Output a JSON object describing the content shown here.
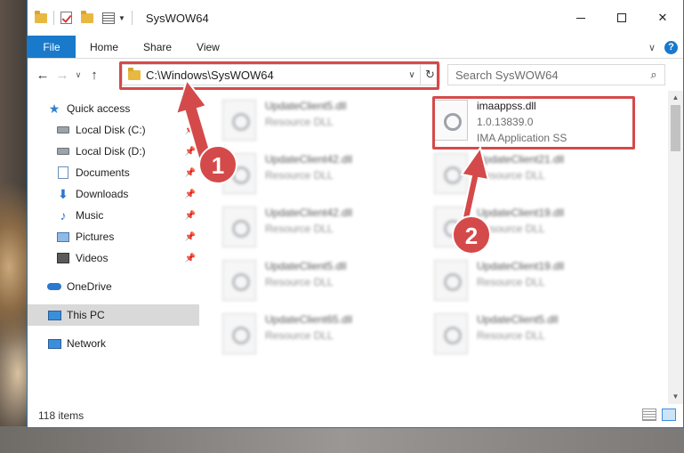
{
  "window": {
    "title": "SysWOW64",
    "controls": {
      "minimize": "",
      "maximize": "",
      "close": "✕"
    }
  },
  "ribbon": {
    "file_tab": "File",
    "tabs": [
      "Home",
      "Share",
      "View"
    ]
  },
  "address": {
    "path": "C:\\Windows\\SysWOW64",
    "search_placeholder": "Search SysWOW64"
  },
  "nav": {
    "items": [
      {
        "label": "Quick access",
        "icon": "star-icon"
      },
      {
        "label": "Local Disk (C:)",
        "icon": "drive-icon",
        "pinned": true
      },
      {
        "label": "Local Disk (D:)",
        "icon": "drive-icon",
        "pinned": true
      },
      {
        "label": "Documents",
        "icon": "documents-icon",
        "pinned": true
      },
      {
        "label": "Downloads",
        "icon": "download-icon",
        "pinned": true
      },
      {
        "label": "Music",
        "icon": "music-icon",
        "pinned": true
      },
      {
        "label": "Pictures",
        "icon": "pictures-icon",
        "pinned": true
      },
      {
        "label": "Videos",
        "icon": "videos-icon",
        "pinned": true
      },
      {
        "label": "OneDrive",
        "icon": "cloud-icon"
      },
      {
        "label": "This PC",
        "icon": "monitor-icon",
        "selected": true
      },
      {
        "label": "Network",
        "icon": "network-icon"
      }
    ]
  },
  "files": {
    "highlighted": {
      "name": "imaappss.dll",
      "version": "1.0.13839.0",
      "description": "IMA Application SS"
    },
    "left_column": [
      {
        "name": "UpdateClient5.dll",
        "type": "Resource DLL"
      },
      {
        "name": "UpdateClient42.dll",
        "type": "Resource DLL"
      },
      {
        "name": "UpdateClient42.dll",
        "type": "Resource DLL"
      },
      {
        "name": "UpdateClient5.dll",
        "type": "Resource DLL"
      },
      {
        "name": "UpdateClient65.dll",
        "type": "Resource DLL"
      }
    ],
    "right_column": [
      {
        "name": "UpdateClient21.dll",
        "type": "Resource DLL"
      },
      {
        "name": "UpdateClient19.dll",
        "type": "Resource DLL"
      },
      {
        "name": "UpdateClient19.dll",
        "type": "Resource DLL"
      },
      {
        "name": "UpdateClient5.dll",
        "type": "Resource DLL"
      }
    ]
  },
  "status": {
    "item_count": "118 items"
  },
  "annotations": {
    "step1": "1",
    "step2": "2",
    "color": "#d44a4a"
  }
}
